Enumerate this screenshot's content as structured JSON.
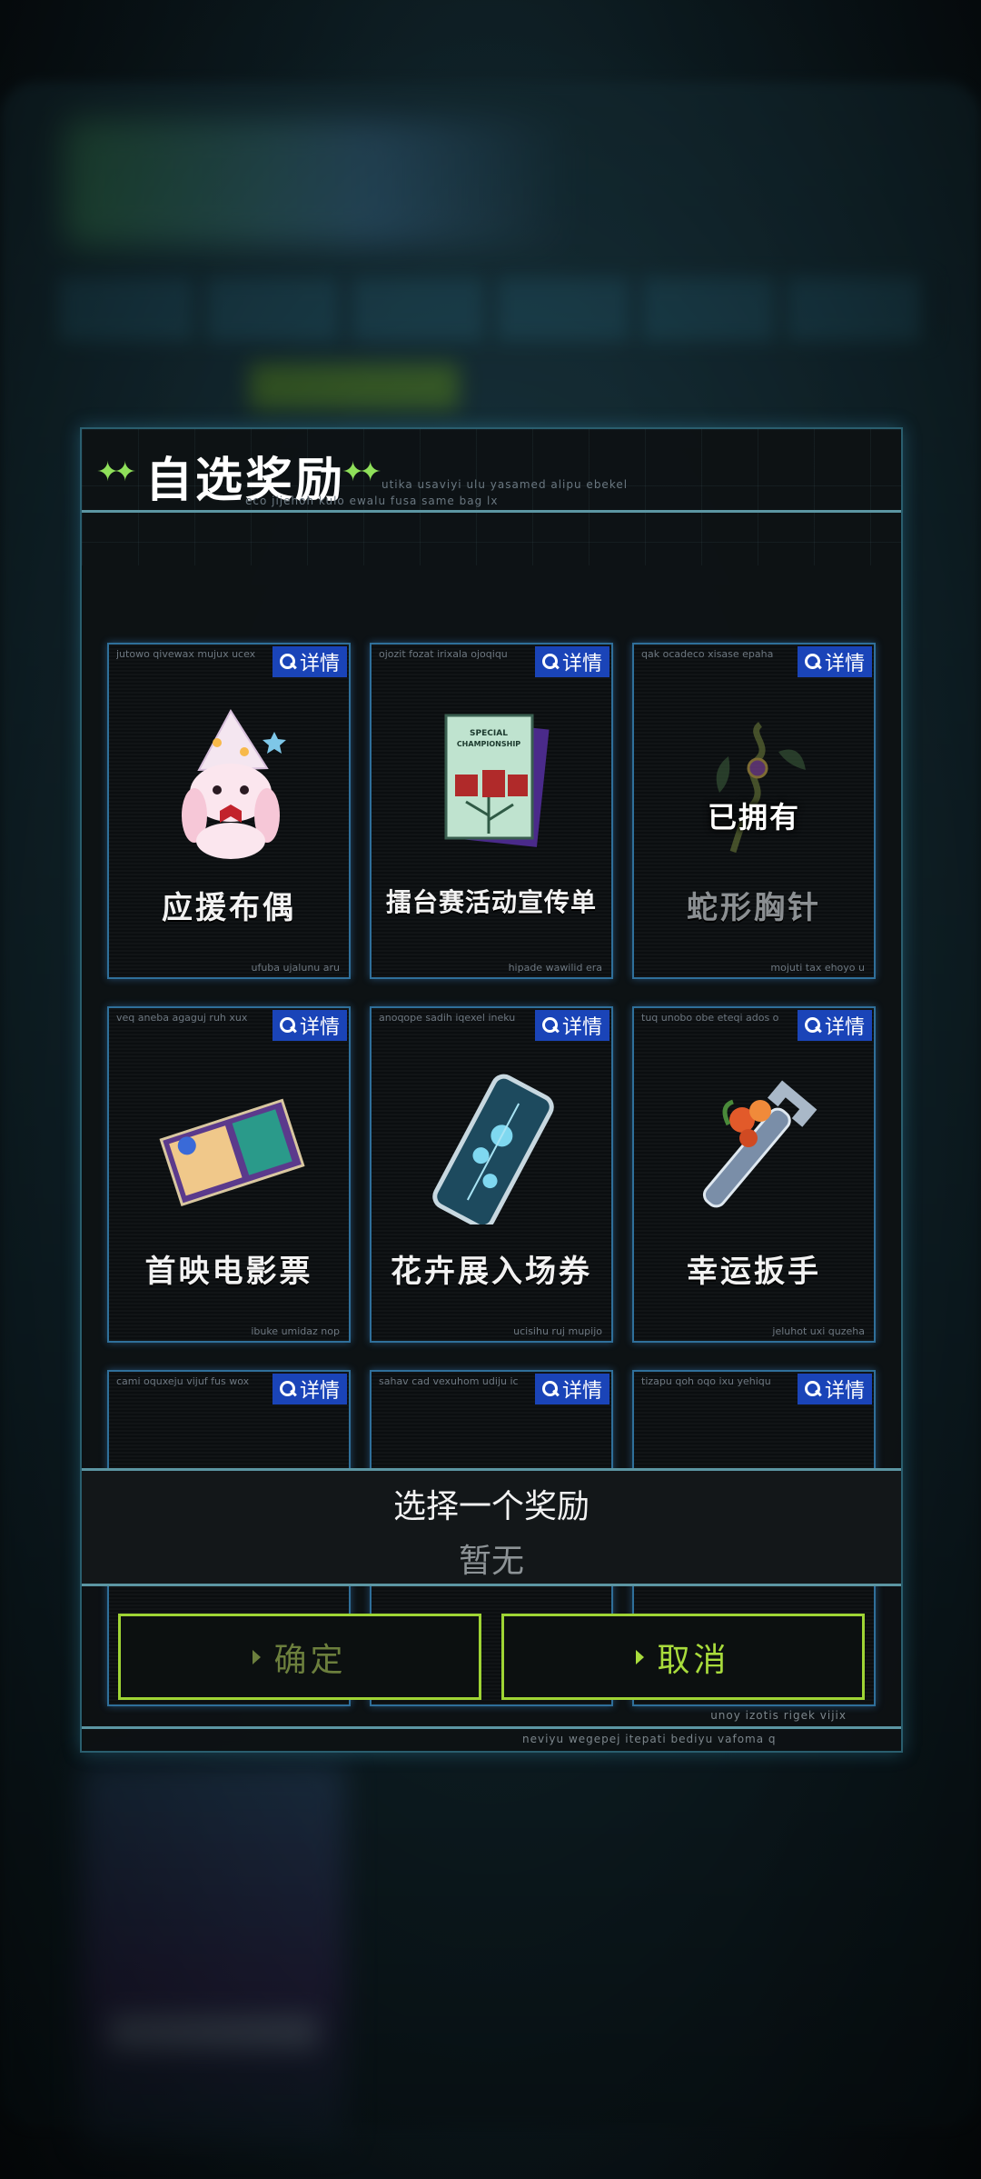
{
  "dialog": {
    "title": "自选奖励",
    "title_sub_1": "utika usaviyi ulu yasamed alipu ebekel",
    "title_sub_2": "eco jijehoh kulo ewalu fusa same bag lx"
  },
  "cards": [
    {
      "name": "应援布偶",
      "top_code": "jutowo qivewax mujux ucex",
      "bottom_code": "ufuba ujalunu aru",
      "detail_label": "详情",
      "owned": false,
      "icon": "plush-bunny-icon"
    },
    {
      "name": "擂台赛活动宣传单",
      "top_code": "ojozit fozat irixala ojoqiqu",
      "bottom_code": "hipade wawilid era",
      "detail_label": "详情",
      "owned": false,
      "icon": "championship-flyer-icon",
      "art_text_1": "SPECIAL",
      "art_text_2": "CHAMPIONSHIP"
    },
    {
      "name": "蛇形胸针",
      "top_code": "qak ocadeco xisase epaha",
      "bottom_code": "mojuti tax ehoyo u",
      "detail_label": "详情",
      "owned": true,
      "owned_label": "已拥有",
      "icon": "snake-brooch-icon"
    },
    {
      "name": "首映电影票",
      "top_code": "veq aneba agaguj ruh xux",
      "bottom_code": "ibuke umidaz nop",
      "detail_label": "详情",
      "owned": false,
      "icon": "movie-ticket-icon"
    },
    {
      "name": "花卉展入场券",
      "top_code": "anoqope sadih iqexel ineku",
      "bottom_code": "ucisihu ruj mupijo",
      "detail_label": "详情",
      "owned": false,
      "icon": "flower-show-ticket-icon"
    },
    {
      "name": "幸运扳手",
      "top_code": "tuq unobo obe eteqi ados o",
      "bottom_code": "jeluhot uxi quzeha",
      "detail_label": "详情",
      "owned": false,
      "icon": "lucky-wrench-icon"
    },
    {
      "name": "",
      "top_code": "cami oquxeju vijuf fus wox",
      "bottom_code": "",
      "detail_label": "详情",
      "owned": false,
      "icon": "bulb-item-icon"
    },
    {
      "name": "",
      "top_code": "sahav cad vexuhom udiju ic",
      "bottom_code": "",
      "detail_label": "详情",
      "owned": false,
      "icon": "helmet-item-icon"
    },
    {
      "name": "",
      "top_code": "tizapu qoh oqo ixu yehiqu",
      "bottom_code": "",
      "detail_label": "详情",
      "owned": false,
      "icon": "dark-orb-item-icon"
    }
  ],
  "selection": {
    "title": "选择一个奖励",
    "value": "暂无"
  },
  "buttons": {
    "confirm_label": "确定",
    "cancel_label": "取消"
  },
  "footer": {
    "code_1": "unoy izotis rigek vijix",
    "code_2": "neviyu wegepej itepati bediyu vafoma q"
  },
  "colors": {
    "accent_green": "#9fd434",
    "detail_blue": "#1a44b8",
    "frame_teal": "#5c96a3"
  }
}
